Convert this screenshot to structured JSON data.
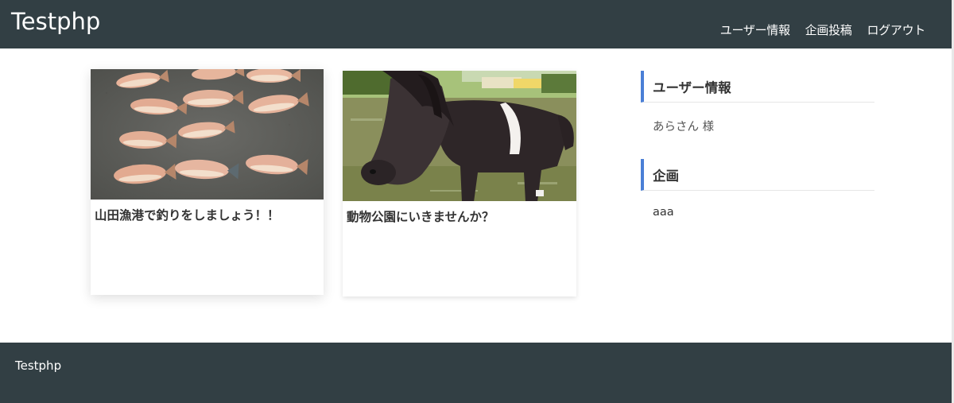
{
  "header": {
    "site_title": "Testphp",
    "nav": [
      "ユーザー情報",
      "企画投稿",
      "ログアウト"
    ]
  },
  "cards": [
    {
      "title": "山田漁港で釣りをしましょう！！",
      "image": "fish-photo"
    },
    {
      "title": "動物公園にいきませんか？",
      "image": "pony-photo"
    }
  ],
  "sidebar": {
    "user_heading": "ユーザー情報",
    "user_name": "あらさん 様",
    "plan_heading": "企画",
    "plan_item": "aaa"
  },
  "footer": {
    "title": "Testphp"
  },
  "colors": {
    "header_bg": "#323f44",
    "accent": "#4a7fd6"
  }
}
